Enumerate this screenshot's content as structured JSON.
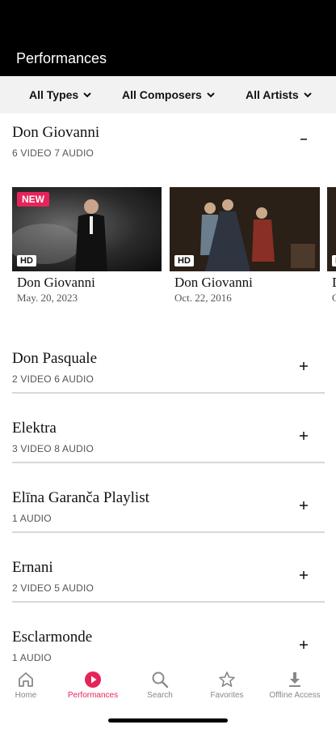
{
  "header": {
    "title": "Performances"
  },
  "filters": {
    "types": "All Types",
    "composers": "All Composers",
    "artists": "All Artists"
  },
  "expanded": {
    "title": "Don Giovanni",
    "subtitle": "6 VIDEO 7 AUDIO",
    "cards": [
      {
        "title": "Don Giovanni",
        "date": "May. 20, 2023",
        "new_badge": "NEW",
        "hd_badge": "HD"
      },
      {
        "title": "Don Giovanni",
        "date": "Oct. 22, 2016",
        "hd_badge": "HD"
      },
      {
        "title": "D",
        "date": "O",
        "hd_badge": "HD"
      }
    ]
  },
  "sections": [
    {
      "title": "Don Pasquale",
      "subtitle": "2 VIDEO 6 AUDIO"
    },
    {
      "title": "Elektra",
      "subtitle": "3 VIDEO 8 AUDIO"
    },
    {
      "title": "Elīna Garanča Playlist",
      "subtitle": "1 AUDIO"
    },
    {
      "title": "Ernani",
      "subtitle": "2 VIDEO 5 AUDIO"
    },
    {
      "title": "Esclarmonde",
      "subtitle": "1 AUDIO"
    }
  ],
  "tabbar": {
    "home": "Home",
    "performances": "Performances",
    "search": "Search",
    "favorites": "Favorites",
    "offline": "Offline Access"
  },
  "colors": {
    "accent": "#e6245a",
    "header_bg": "#000000",
    "filter_bg": "#f2f2f2"
  }
}
